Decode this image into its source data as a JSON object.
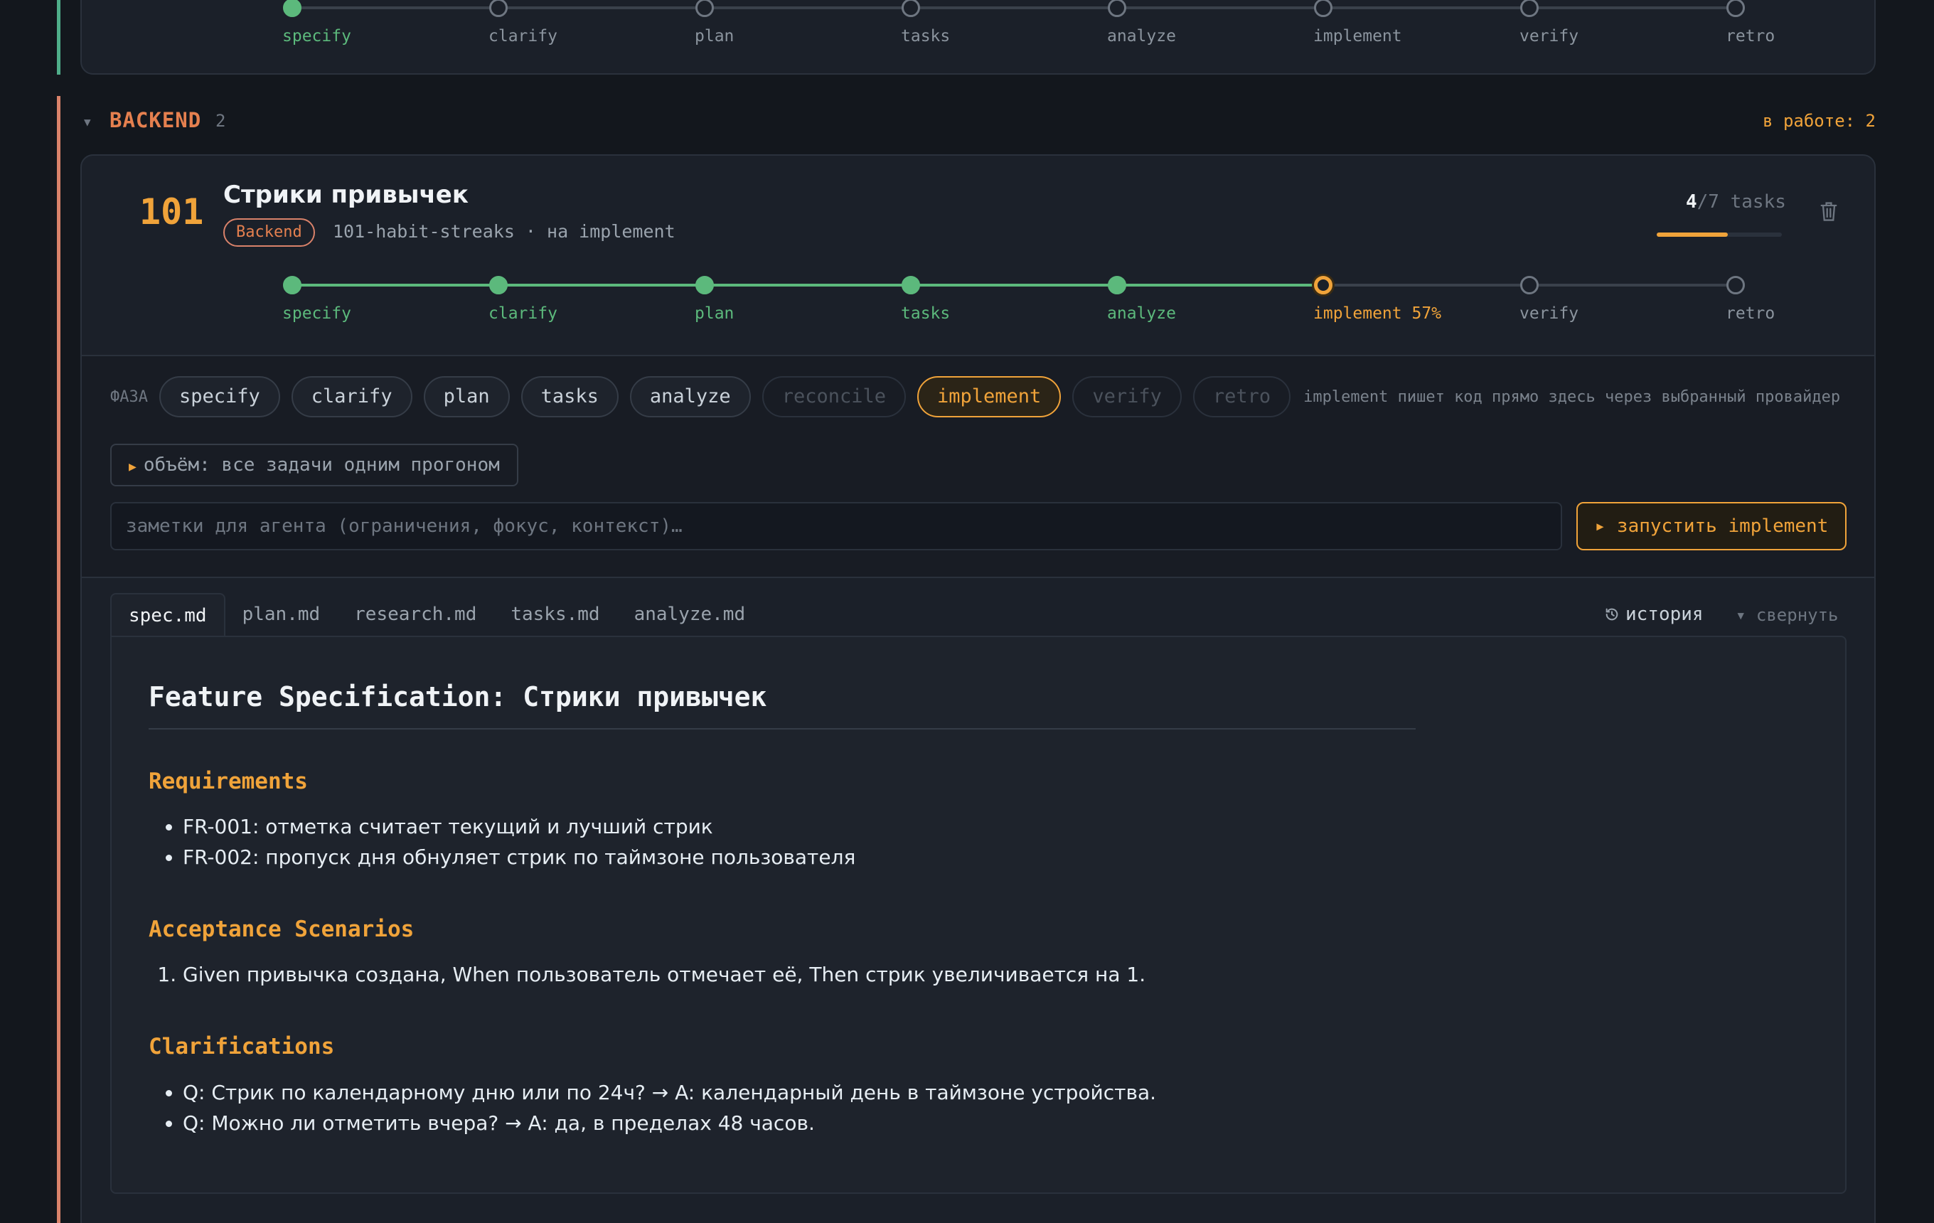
{
  "top_card": {
    "steps": [
      {
        "label": "specify",
        "state": "done"
      },
      {
        "label": "clarify",
        "state": "pending"
      },
      {
        "label": "plan",
        "state": "pending"
      },
      {
        "label": "tasks",
        "state": "pending"
      },
      {
        "label": "analyze",
        "state": "pending"
      },
      {
        "label": "implement",
        "state": "pending"
      },
      {
        "label": "verify",
        "state": "pending"
      },
      {
        "label": "retro",
        "state": "pending"
      }
    ]
  },
  "group": {
    "name": "BACKEND",
    "count": "2",
    "status": "в работе: 2",
    "accent_color": "#d9826a"
  },
  "feature": {
    "number": "101",
    "title": "Стрики привычек",
    "tag": "Backend",
    "meta": "101-habit-streaks · на implement",
    "tasks_done": "4",
    "tasks_total": "/7 tasks",
    "tasks_progress": 0.57,
    "steps": [
      {
        "label": "specify",
        "state": "done"
      },
      {
        "label": "clarify",
        "state": "done"
      },
      {
        "label": "plan",
        "state": "done"
      },
      {
        "label": "tasks",
        "state": "done"
      },
      {
        "label": "analyze",
        "state": "done"
      },
      {
        "label": "implement 57%",
        "state": "current"
      },
      {
        "label": "verify",
        "state": "pending"
      },
      {
        "label": "retro",
        "state": "pending"
      }
    ]
  },
  "phase": {
    "label": "ФАЗА",
    "chips": [
      {
        "label": "specify",
        "state": "normal"
      },
      {
        "label": "clarify",
        "state": "normal"
      },
      {
        "label": "plan",
        "state": "normal"
      },
      {
        "label": "tasks",
        "state": "normal"
      },
      {
        "label": "analyze",
        "state": "normal"
      },
      {
        "label": "reconcile",
        "state": "disabled"
      },
      {
        "label": "implement",
        "state": "active"
      },
      {
        "label": "verify",
        "state": "disabled"
      },
      {
        "label": "retro",
        "state": "disabled"
      }
    ],
    "hint": "implement пишет код прямо здесь через выбранный провайдер"
  },
  "scope": {
    "label": "объём: все задачи одним прогоном"
  },
  "notes": {
    "value": "",
    "placeholder": "заметки для агента (ограничения, фокус, контекст)…"
  },
  "run_button": {
    "label": "▸ запустить implement"
  },
  "tabs": [
    {
      "label": "spec.md",
      "active": true
    },
    {
      "label": "plan.md",
      "active": false
    },
    {
      "label": "research.md",
      "active": false
    },
    {
      "label": "tasks.md",
      "active": false
    },
    {
      "label": "analyze.md",
      "active": false
    }
  ],
  "history_label": "история",
  "collapse_label": "▾ свернуть",
  "doc": {
    "title": "Feature Specification: Стрики привычек",
    "requirements_heading": "Requirements",
    "requirements": [
      "FR-001: отметка считает текущий и лучший стрик",
      "FR-002: пропуск дня обнуляет стрик по таймзоне пользователя"
    ],
    "acceptance_heading": "Acceptance Scenarios",
    "acceptance": [
      "Given привычка создана, When пользователь отмечает её, Then стрик увеличивается на 1."
    ],
    "clarifications_heading": "Clarifications",
    "clarifications": [
      "Q: Стрик по календарному дню или по 24ч? → A: календарный день в таймзоне устройства.",
      "Q: Можно ли отметить вчера? → A: да, в пределах 48 часов."
    ]
  },
  "colors": {
    "done": "#5cb97c",
    "current": "#f0a33a",
    "pending": "#6e7681",
    "top_stripe": "#4fae8a"
  }
}
